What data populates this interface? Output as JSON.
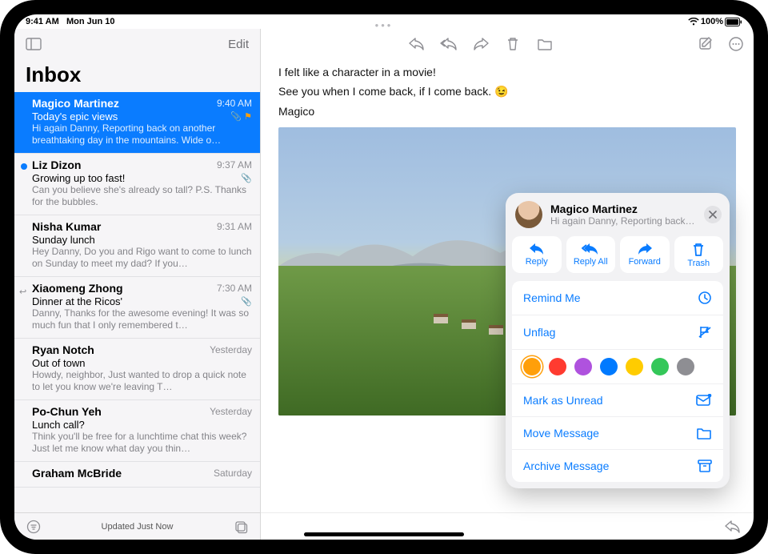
{
  "statusbar": {
    "time": "9:41 AM",
    "date": "Mon Jun 10",
    "battery": "100%"
  },
  "sidebar": {
    "edit": "Edit",
    "title": "Inbox",
    "footer_status": "Updated Just Now",
    "items": [
      {
        "sender": "Magico Martinez",
        "time": "9:40 AM",
        "subject": "Today's epic views",
        "preview": "Hi again Danny, Reporting back on another breathtaking day in the mountains. Wide o…",
        "selected": true,
        "clip": true,
        "flag": true
      },
      {
        "sender": "Liz Dizon",
        "time": "9:37 AM",
        "subject": "Growing up too fast!",
        "preview": "Can you believe she's already so tall? P.S. Thanks for the bubbles.",
        "clip": true,
        "unread": true
      },
      {
        "sender": "Nisha Kumar",
        "time": "9:31 AM",
        "subject": "Sunday lunch",
        "preview": "Hey Danny, Do you and Rigo want to come to lunch on Sunday to meet my dad? If you…"
      },
      {
        "sender": "Xiaomeng Zhong",
        "time": "7:30 AM",
        "subject": "Dinner at the Ricos'",
        "preview": "Danny, Thanks for the awesome evening! It was so much fun that I only remembered t…",
        "clip": true,
        "replied": true
      },
      {
        "sender": "Ryan Notch",
        "time": "Yesterday",
        "subject": "Out of town",
        "preview": "Howdy, neighbor, Just wanted to drop a quick note to let you know we're leaving T…"
      },
      {
        "sender": "Po-Chun Yeh",
        "time": "Yesterday",
        "subject": "Lunch call?",
        "preview": "Think you'll be free for a lunchtime chat this week? Just let me know what day you thin…"
      },
      {
        "sender": "Graham McBride",
        "time": "Saturday",
        "subject": "",
        "preview": ""
      }
    ]
  },
  "message": {
    "line1": "I felt like a character in a movie!",
    "line2_prefix": "See you when I come back, if I come back. ",
    "emoji": "😉",
    "signature": "Magico"
  },
  "popover": {
    "name": "Magico Martinez",
    "snippet": "Hi again Danny, Reporting back o…",
    "quick": {
      "reply": "Reply",
      "reply_all": "Reply All",
      "forward": "Forward",
      "trash": "Trash"
    },
    "menu": {
      "remind": "Remind Me",
      "unflag": "Unflag",
      "mark_unread": "Mark as Unread",
      "move": "Move Message",
      "archive": "Archive Message"
    },
    "flag_colors": [
      "#ff9f0a",
      "#ff3b30",
      "#af52de",
      "#007aff",
      "#ffcc00",
      "#34c759",
      "#8e8e93"
    ]
  }
}
